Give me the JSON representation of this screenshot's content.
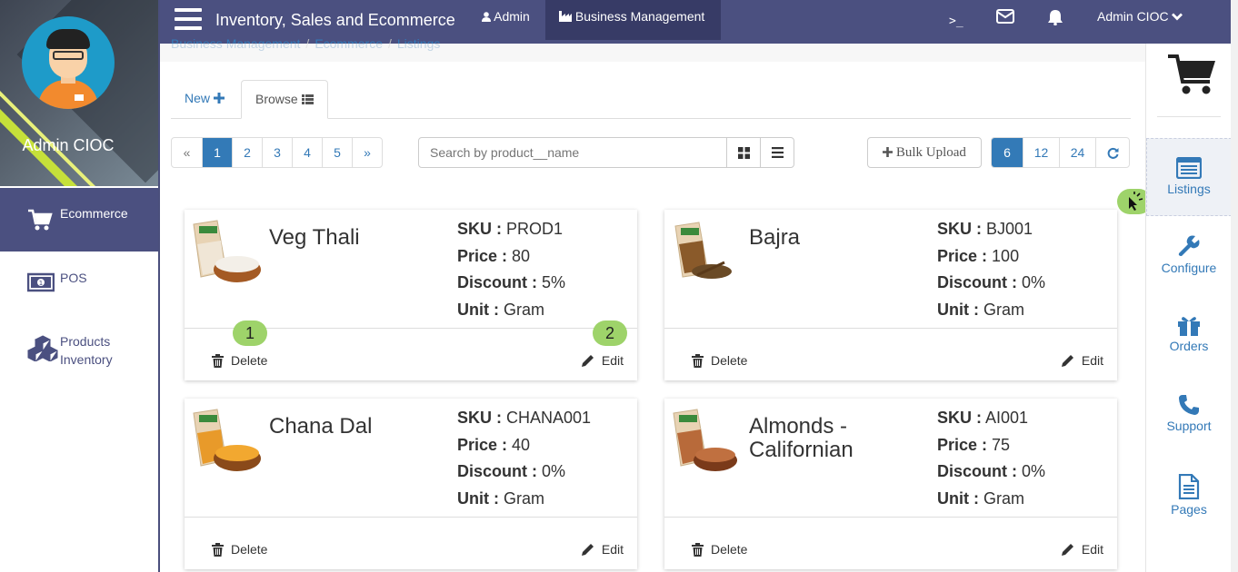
{
  "app": {
    "title": "Inventory, Sales and Ecommerce"
  },
  "topnav": {
    "admin_label": "Admin",
    "business_label": "Business Management",
    "terminal_glyph": ">_",
    "user_label": "Admin CIOC"
  },
  "profile": {
    "name": "Admin CIOC"
  },
  "sidebar": {
    "items": [
      {
        "label": "Ecommerce",
        "icon": "cart-icon",
        "active": true
      },
      {
        "label": "POS",
        "icon": "money-icon",
        "active": false
      },
      {
        "label": "Products Inventory",
        "icon": "cubes-icon",
        "active": false
      }
    ]
  },
  "breadcrumb": [
    "Business Management",
    "Ecommerce",
    "Listings"
  ],
  "tabs": {
    "new": "New",
    "browse": "Browse"
  },
  "pagination": [
    "«",
    "1",
    "2",
    "3",
    "4",
    "5",
    "»"
  ],
  "search": {
    "placeholder": "Search by product__name"
  },
  "bulk_upload": "Bulk Upload",
  "page_sizes": [
    "6",
    "12",
    "24"
  ],
  "labels": {
    "sku": "SKU :",
    "price": "Price :",
    "discount": "Discount :",
    "unit": "Unit :",
    "delete": "Delete",
    "edit": "Edit"
  },
  "products": [
    {
      "name": "Veg Thali",
      "sku": "PROD1",
      "price": "80",
      "discount": "5%",
      "unit": "Gram"
    },
    {
      "name": "Bajra",
      "sku": "BJ001",
      "price": "100",
      "discount": "0%",
      "unit": "Gram"
    },
    {
      "name": "Chana Dal",
      "sku": "CHANA001",
      "price": "40",
      "discount": "0%",
      "unit": "Gram"
    },
    {
      "name": "Almonds - Californian",
      "sku": "AI001",
      "price": "75",
      "discount": "0%",
      "unit": "Gram"
    }
  ],
  "right_sidebar": [
    {
      "label": "Listings",
      "icon": "list-icon",
      "active": true
    },
    {
      "label": "Configure",
      "icon": "wrench-icon"
    },
    {
      "label": "Orders",
      "icon": "gift-icon"
    },
    {
      "label": "Support",
      "icon": "phone-icon"
    },
    {
      "label": "Pages",
      "icon": "file-icon"
    }
  ],
  "markers": [
    "1",
    "2"
  ],
  "colors": {
    "primary": "#4b5080",
    "active_tab": "#373b66",
    "link": "#3379b7",
    "marker": "#9ed36a"
  }
}
